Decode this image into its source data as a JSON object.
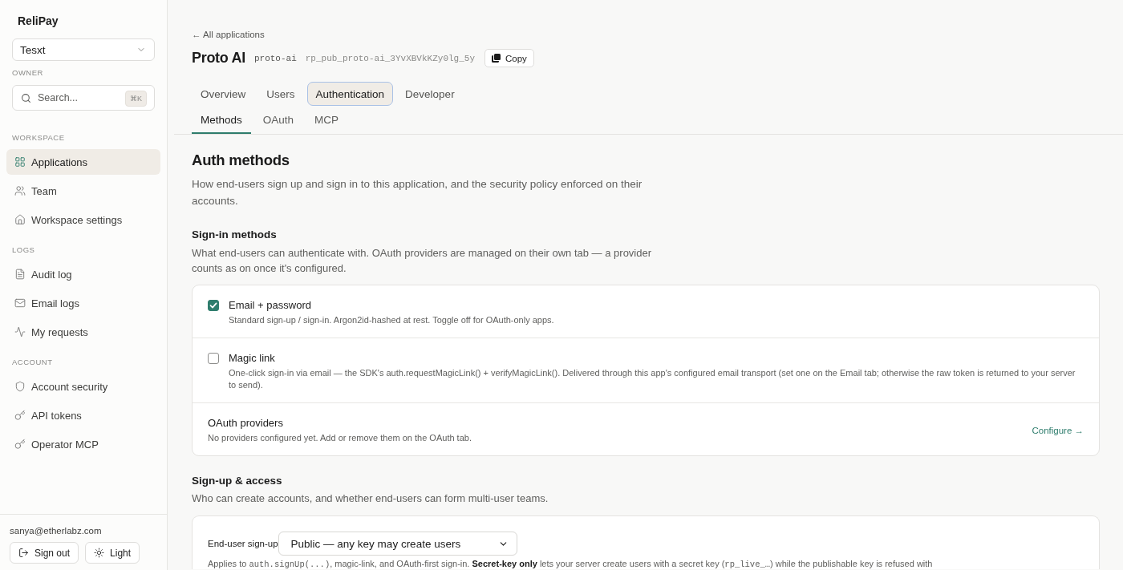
{
  "sidebar": {
    "brand": "ReliPay",
    "workspace": {
      "value": "Tesxt"
    },
    "role": "OWNER",
    "search": {
      "placeholder": "Search...",
      "shortcut": "⌘K"
    },
    "sections": [
      {
        "heading": "WORKSPACE",
        "items": [
          {
            "label": "Applications",
            "selected": true
          },
          {
            "label": "Team",
            "selected": false
          },
          {
            "label": "Workspace settings",
            "selected": false
          }
        ]
      },
      {
        "heading": "LOGS",
        "items": [
          {
            "label": "Audit log",
            "selected": false
          },
          {
            "label": "Email logs",
            "selected": false
          },
          {
            "label": "My requests",
            "selected": false
          }
        ]
      },
      {
        "heading": "ACCOUNT",
        "items": [
          {
            "label": "Account security",
            "selected": false
          },
          {
            "label": "API tokens",
            "selected": false
          },
          {
            "label": "Operator MCP",
            "selected": false
          }
        ]
      }
    ],
    "footer": {
      "email": "sanya@etherlabz.com",
      "buttons": [
        "Sign out",
        "Light"
      ]
    }
  },
  "header": {
    "back_link": "← All applications",
    "title": "Proto AI",
    "slug": "proto-ai",
    "public_key": "rp_pub_proto-ai_3YvXBVkKZy0lg_5y",
    "copy_button": "Copy",
    "tabs": [
      {
        "label": "Overview",
        "selected": false
      },
      {
        "label": "Users",
        "selected": false
      },
      {
        "label": "Authentication",
        "selected": true
      },
      {
        "label": "Developer",
        "selected": false
      }
    ],
    "subtabs": [
      {
        "label": "Methods",
        "selected": true
      },
      {
        "label": "OAuth",
        "selected": false
      },
      {
        "label": "MCP",
        "selected": false
      }
    ]
  },
  "page": {
    "title": "Auth methods",
    "description": "How end-users sign up and sign in to this application, and the security policy enforced on their accounts."
  },
  "sign_in_methods": {
    "title": "Sign-in methods",
    "description": "What end-users can authenticate with. OAuth providers are managed on their own tab — a provider counts as on once it's configured.",
    "items": [
      {
        "kind": "checkbox",
        "title": "Email + password",
        "description": "Standard sign-up / sign-in. Argon2id-hashed at rest. Toggle off for OAuth-only apps.",
        "checked": true
      },
      {
        "kind": "checkbox",
        "title": "Magic link",
        "description": "One-click sign-in via email — the SDK's auth.requestMagicLink() + verifyMagicLink(). Delivered through this app's configured email transport (set one on the Email tab; otherwise the raw token is returned to your server to send).",
        "checked": false
      },
      {
        "kind": "link",
        "title": "OAuth providers",
        "description": "No providers configured yet. Add or remove them on the OAuth tab.",
        "action": "Configure →"
      }
    ]
  },
  "signup_access": {
    "title": "Sign-up & access",
    "description": "Who can create accounts, and whether end-users can form multi-user teams.",
    "field": {
      "label": "End-user sign-up",
      "value": "Public — any key may create users"
    },
    "help": [
      {
        "kind": "text",
        "text": "Applies to "
      },
      {
        "kind": "code",
        "text": "auth.signUp(...)"
      },
      {
        "kind": "text",
        "text": ", magic-link, and OAuth-first sign-in. "
      },
      {
        "kind": "bold",
        "text": "Secret-key only"
      },
      {
        "kind": "text",
        "text": " lets your server create users with a secret key ("
      },
      {
        "kind": "code",
        "text": "rp_live_…"
      },
      {
        "kind": "text",
        "text": ") while the publishable key is refused with"
      }
    ]
  }
}
